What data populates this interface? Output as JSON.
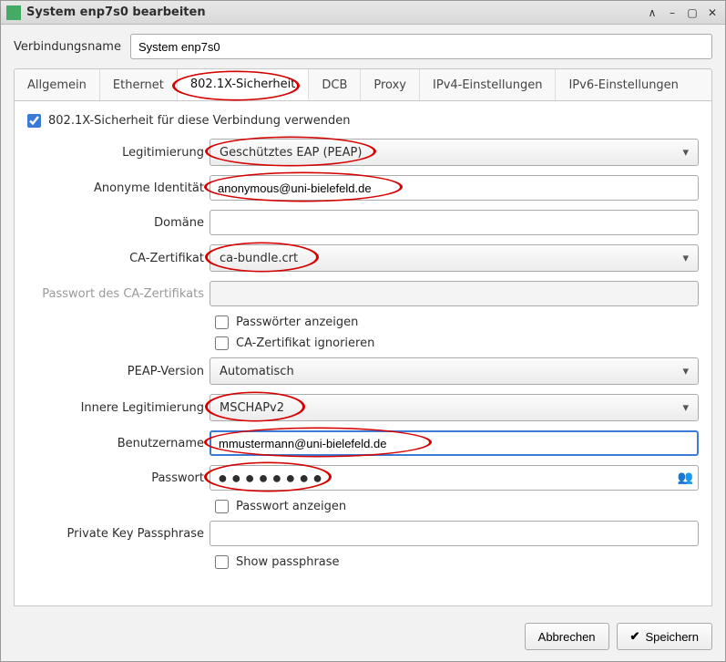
{
  "window": {
    "title": "System enp7s0 bearbeiten"
  },
  "connection": {
    "label": "Verbindungsname",
    "value": "System enp7s0"
  },
  "tabs": {
    "allgemein": "Allgemein",
    "ethernet": "Ethernet",
    "sec8021x": "802.1X-Sicherheit",
    "dcb": "DCB",
    "proxy": "Proxy",
    "ipv4": "IPv4-Einstellungen",
    "ipv6": "IPv6-Einstellungen"
  },
  "sec": {
    "use8021x": "802.1X-Sicherheit für diese Verbindung verwenden",
    "auth_label": "Legitimierung",
    "auth_value": "Geschütztes EAP (PEAP)",
    "anon_label": "Anonyme Identität",
    "anon_value": "anonymous@uni-bielefeld.de",
    "domain_label": "Domäne",
    "domain_value": "",
    "ca_label": "CA-Zertifikat",
    "ca_value": "ca-bundle.crt",
    "ca_pw_label": "Passwort des CA-Zertifikats",
    "ca_pw_value": "",
    "show_pw": "Passwörter anzeigen",
    "ignore_ca": "CA-Zertifikat ignorieren",
    "peap_label": "PEAP-Version",
    "peap_value": "Automatisch",
    "inner_label": "Innere Legitimierung",
    "inner_value": "MSCHAPv2",
    "user_label": "Benutzername",
    "user_value": "mmustermann@uni-bielefeld.de",
    "pw_label": "Passwort",
    "pw_value": "●●●●●●●●",
    "show_single_pw": "Passwort anzeigen",
    "pk_label": "Private Key Passphrase",
    "pk_value": "",
    "show_passphrase": "Show passphrase"
  },
  "buttons": {
    "cancel": "Abbrechen",
    "save": "Speichern"
  }
}
